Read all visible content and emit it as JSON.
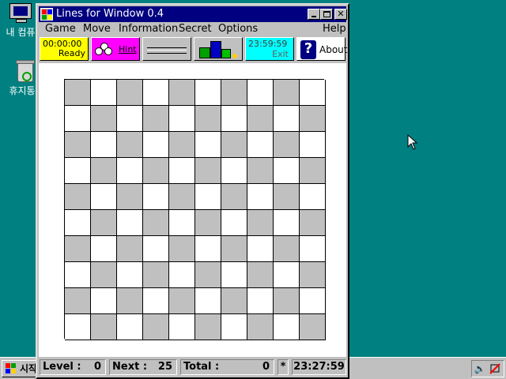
{
  "desktop": {
    "icons": [
      {
        "label": "내 컴퓨"
      },
      {
        "label": "휴지통"
      }
    ]
  },
  "taskbar": {
    "start_label": "시작",
    "tray_icons": [
      "speaker-icon",
      "network-icon"
    ]
  },
  "window": {
    "title": "Lines for Window 0.4",
    "menu": [
      {
        "label": "Game"
      },
      {
        "label": "Move"
      },
      {
        "label": "Information"
      },
      {
        "label": "Secret"
      },
      {
        "label": "Options"
      },
      {
        "label": "Help"
      }
    ],
    "toolbar": {
      "timer_time": "00:00:00",
      "timer_status": "Ready",
      "hint_label": "Hint",
      "clock_time": "23:59:59",
      "clock_label": "Exit",
      "about_label": "About"
    },
    "board": {
      "rows": 10,
      "cols": 10,
      "colors": {
        "dark": "#c0c0c0",
        "light": "#ffffff"
      }
    },
    "status": {
      "level_label": "Level :",
      "level_value": "0",
      "next_label": "Next :",
      "next_value": "25",
      "total_label": "Total :",
      "total_value": "0",
      "flag": "*",
      "time": "23:27:59"
    }
  },
  "colors": {
    "desktop": "#008080",
    "titlebar": "#000080",
    "timer_bg": "#ffff00",
    "hint_bg": "#ff00ff",
    "clock_bg": "#00ffff"
  }
}
